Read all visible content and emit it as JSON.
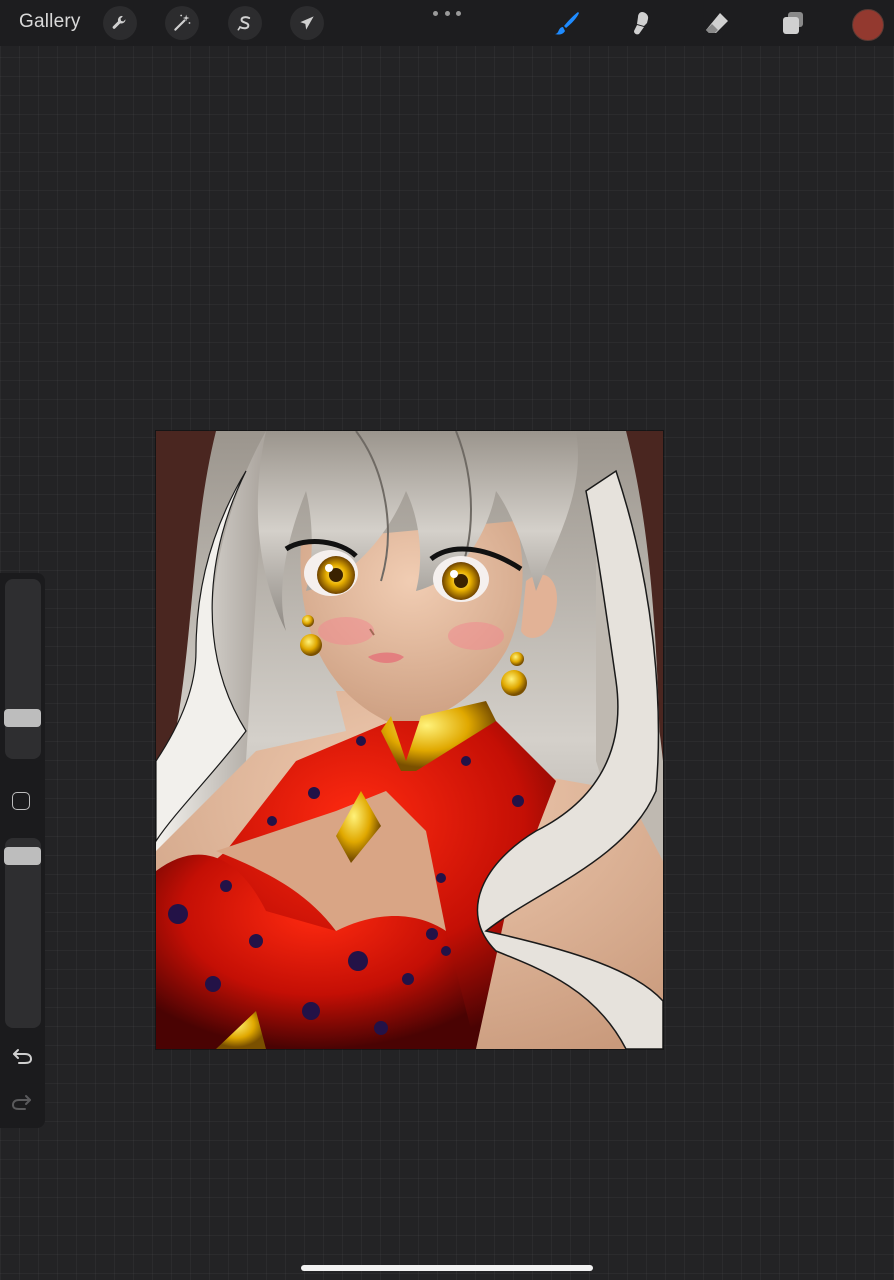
{
  "topbar": {
    "gallery_label": "Gallery",
    "left_tools": [
      {
        "name": "actions",
        "icon": "wrench-icon"
      },
      {
        "name": "adjustments",
        "icon": "magic-wand-icon"
      },
      {
        "name": "selection",
        "icon": "selection-s-icon"
      },
      {
        "name": "transform",
        "icon": "arrow-cursor-icon"
      }
    ],
    "more_icon": "more-dots-icon",
    "right_tools": [
      {
        "name": "brush",
        "icon": "brush-icon",
        "active": true
      },
      {
        "name": "smudge",
        "icon": "smudge-icon",
        "active": false
      },
      {
        "name": "eraser",
        "icon": "eraser-icon",
        "active": false
      },
      {
        "name": "layers",
        "icon": "layers-icon",
        "active": false
      }
    ],
    "current_color": "#93392f"
  },
  "canvas": {
    "artwork": "anime-portrait-illustration",
    "background_color": "#4a2620"
  },
  "sidebar": {
    "brush_size_slider": {
      "icon": "slider-thumb",
      "value": 0.26
    },
    "modify_button_icon": "square-icon",
    "opacity_slider": {
      "icon": "slider-thumb",
      "value": 0.06
    },
    "undo_icon": "undo-icon",
    "redo_icon": "redo-icon"
  },
  "colors": {
    "accent_active": "#1e8bff",
    "icon": "#d0d0d0",
    "topbar_bg": "#1d1d1f",
    "workspace_bg": "#232325"
  }
}
